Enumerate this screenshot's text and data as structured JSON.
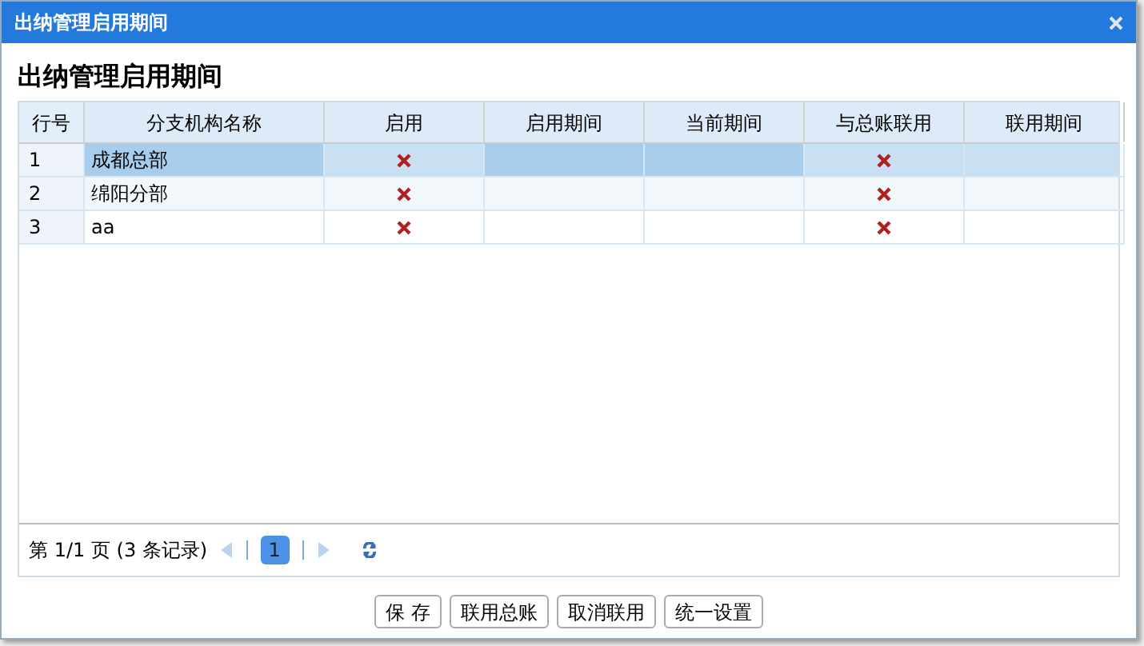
{
  "window": {
    "title": "出纳管理启用期间"
  },
  "heading": "出纳管理启用期间",
  "table": {
    "columns": [
      "行号",
      "分支机构名称",
      "启用",
      "启用期间",
      "当前期间",
      "与总账联用",
      "联用期间"
    ],
    "rows": [
      {
        "no": "1",
        "name": "成都总部",
        "enabled": false,
        "linked": false,
        "selected": true
      },
      {
        "no": "2",
        "name": "绵阳分部",
        "enabled": false,
        "linked": false,
        "selected": false
      },
      {
        "no": "3",
        "name": "aa",
        "enabled": false,
        "linked": false,
        "selected": false
      }
    ]
  },
  "pager": {
    "info": "第 1/1 页 (3 条记录)",
    "pages": [
      {
        "label": "1",
        "selected": true
      }
    ]
  },
  "buttons": [
    "保 存",
    "联用总账",
    "取消联用",
    "统一设置"
  ]
}
